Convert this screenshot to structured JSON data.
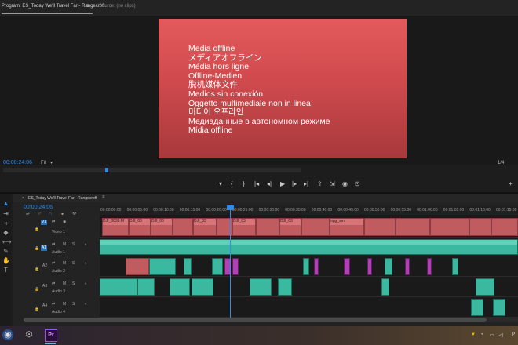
{
  "program_panel": {
    "tab_program": "Program: ES_Today We'll Travel Far - Rangecroft",
    "tab_menu_glyph": "≡",
    "tab_source": "Source: (no clips)",
    "media_offline_lines": [
      "Media offline",
      "メディアオフライン",
      "Média hors ligne",
      "Offline-Medien",
      "脱机媒体文件",
      "Medios sin conexión",
      "Oggetto multimediale non in linea",
      "미디어 오프라인",
      "Медиаданные в автономном режиме",
      "Mídia offline"
    ],
    "timecode": "00:00:24:06",
    "fit_label": "Fit",
    "resolution": "1/4"
  },
  "transport": {
    "buttons": [
      "mark-in",
      "mark-out",
      "go-to-in",
      "step-back",
      "play",
      "step-forward",
      "go-to-out",
      "lift",
      "extract",
      "export-frame",
      "settings"
    ],
    "glyphs": [
      "▾",
      "{",
      "}",
      "|◂",
      "◂|",
      "▶",
      "|▸",
      "▸|",
      "⇪",
      "⇲",
      "◉",
      "⊡"
    ]
  },
  "timeline": {
    "tab_title": "ES_Today We'll Travel Far - Rangecroft",
    "tab_menu_glyph": "≡",
    "close_glyph": "×",
    "timecode": "00:00:24:06",
    "ruler_labels": [
      "00:00:00:00",
      "00:00:05:00",
      "00:00:10:00",
      "00:00:15:00",
      "00:00:20:00",
      "00:00:25:00",
      "00:00:30:00",
      "00:00:35:00",
      "00:00:40:00",
      "00:00:45:00",
      "00:00:50:00",
      "00:00:55:00",
      "00:01:00:00",
      "00:01:05:00",
      "00:01:10:00",
      "00:01:15:00"
    ],
    "tracks": [
      {
        "id": "V1",
        "name": "Video 1",
        "target": "V1"
      },
      {
        "id": "A1",
        "name": "Audio 1",
        "target": "A1"
      },
      {
        "id": "A2",
        "name": "Audio 2",
        "target": ""
      },
      {
        "id": "A3",
        "name": "Audio 3",
        "target": ""
      },
      {
        "id": "A4",
        "name": "Audio 4",
        "target": ""
      }
    ],
    "track_buttons": {
      "mute": "M",
      "solo": "S"
    },
    "video_clip_labels": [
      "DJI_0036.M",
      "DJI_00",
      "DJI_00",
      "DJI_03",
      "DJI_03",
      "DJI_03",
      "ogg_sm"
    ]
  },
  "taskbar": {
    "apps": [
      "firefox",
      "steam",
      "premiere-pro"
    ],
    "premiere_label": "Pr",
    "tray_label": "P"
  },
  "colors": {
    "accent_blue": "#2d8ceb",
    "video_clip": "#c05b60",
    "audio_clip": "#3bb9a0",
    "audio_clip_alt": "#b23fb5",
    "offline_frame": "#d9505a"
  }
}
